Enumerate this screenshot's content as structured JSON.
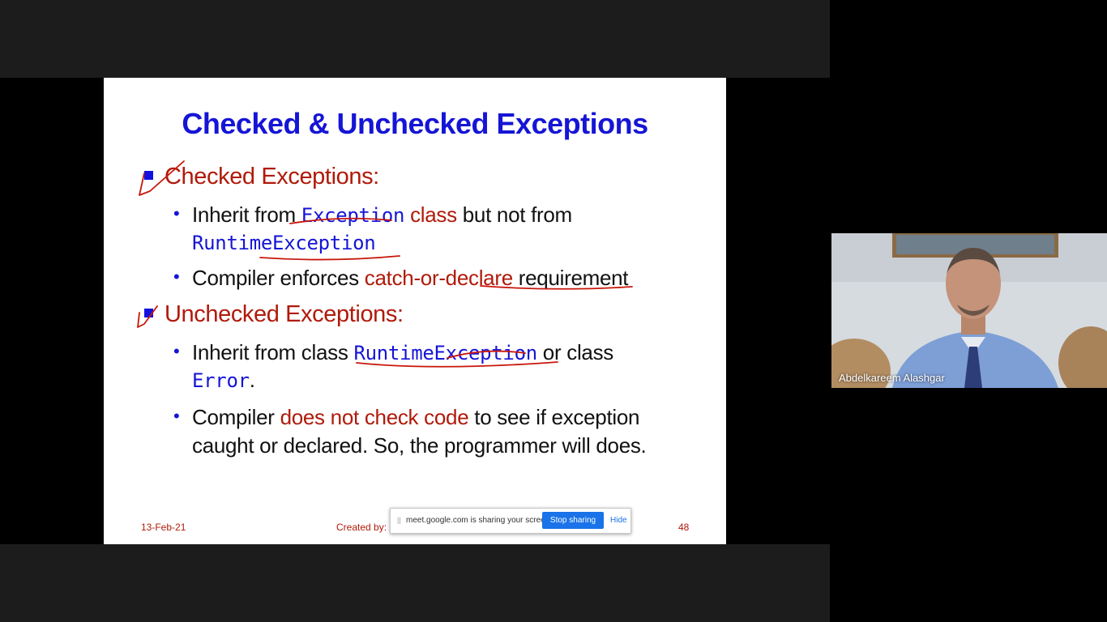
{
  "slide": {
    "title": "Checked & Unchecked Exceptions",
    "checked": {
      "heading": "Checked Exceptions:",
      "b1_pre": "Inherit from ",
      "b1_code": "Exception",
      "b1_red": " class",
      "b1_post": " but not from",
      "b1_code2": "RuntimeException",
      "b2_pre": "Compiler enforces ",
      "b2_red": "catch-or-declare",
      "b2_post": " requirement"
    },
    "unchecked": {
      "heading": "Unchecked Exceptions:",
      "b1_pre": "Inherit from class ",
      "b1_code": "RuntimeException",
      "b1_post": " or class",
      "b1_code2": "Error",
      "b1_end": ".",
      "b2_pre": "Compiler ",
      "b2_red": "does not check code",
      "b2_post": " to see if exception",
      "b2_line2": "caught or declared. So, the programmer will does."
    },
    "footer": {
      "date": "13-Feb-21",
      "created": "Created by: D",
      "page": "48"
    }
  },
  "share_bar": {
    "grip": "||",
    "message": "meet.google.com is sharing your screen.",
    "stop_label": "Stop sharing",
    "hide_label": "Hide"
  },
  "participant": {
    "name": "Abdelkareem Alashgar"
  },
  "colors": {
    "title_blue": "#1515d6",
    "heading_red": "#b01a0a",
    "ink_red": "#c8160a",
    "share_blue": "#1a73e8"
  }
}
